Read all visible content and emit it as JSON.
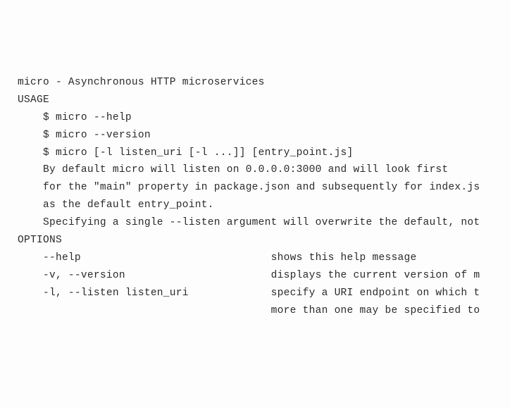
{
  "lines": [
    "micro - Asynchronous HTTP microservices",
    "",
    "USAGE",
    "",
    "    $ micro --help",
    "    $ micro --version",
    "    $ micro [-l listen_uri [-l ...]] [entry_point.js]",
    "",
    "    By default micro will listen on 0.0.0.0:3000 and will look first",
    "    for the \"main\" property in package.json and subsequently for index.js",
    "    as the default entry_point.",
    "",
    "    Specifying a single --listen argument will overwrite the default, not",
    "",
    "OPTIONS",
    "",
    "    --help                              shows this help message",
    "",
    "    -v, --version                       displays the current version of m",
    "",
    "    -l, --listen listen_uri             specify a URI endpoint on which t",
    "                                        more than one may be specified to"
  ]
}
